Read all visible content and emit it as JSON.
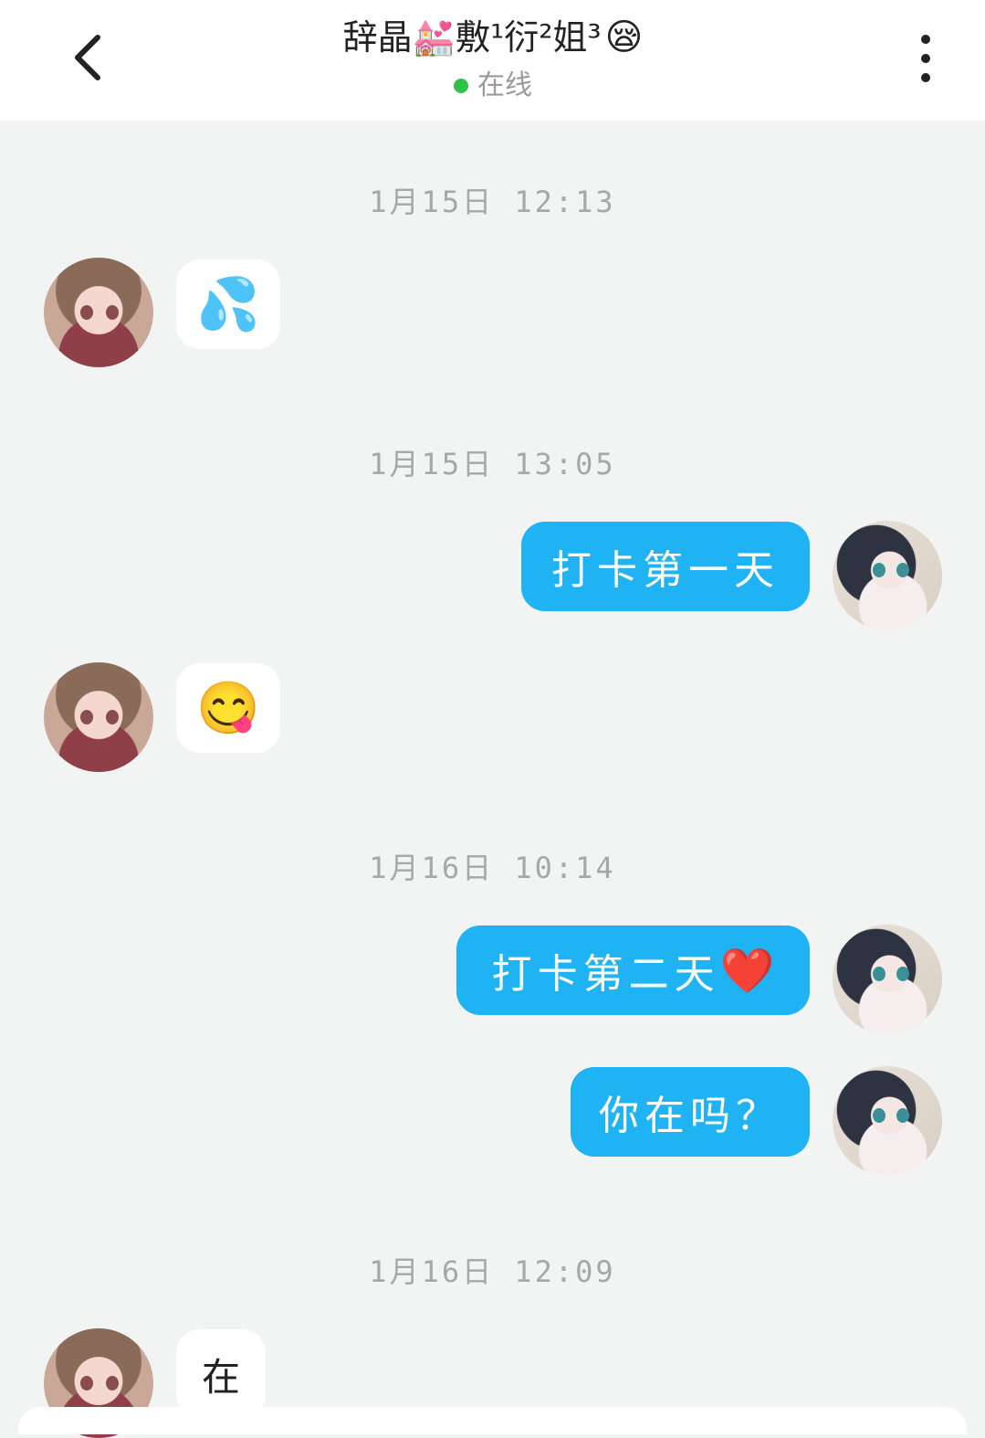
{
  "header": {
    "back_icon": "chevron-left-icon",
    "title": "辞晶💒敷¹衍²姐³",
    "title_emoji": "😪",
    "status": "在线",
    "status_color": "#2fc24a",
    "more_icon": "more-vertical-icon"
  },
  "messages": [
    {
      "type": "time",
      "text": "1月15日 12:13"
    },
    {
      "type": "msg",
      "side": "left",
      "text": "💦"
    },
    {
      "type": "time",
      "text": "1月15日 13:05"
    },
    {
      "type": "msg",
      "side": "right",
      "text": "打卡第一天"
    },
    {
      "type": "msg",
      "side": "left",
      "text": "😋"
    },
    {
      "type": "time",
      "text": "1月16日 10:14"
    },
    {
      "type": "msg",
      "side": "right",
      "text": "打卡第二天",
      "emoji": "❤️"
    },
    {
      "type": "msg",
      "side": "right",
      "text": "你在吗？"
    },
    {
      "type": "time",
      "text": "1月16日 12:09"
    },
    {
      "type": "msg",
      "side": "left",
      "text": "在"
    }
  ],
  "colors": {
    "bubble_self": "#1fb3f3",
    "bubble_other": "#ffffff",
    "background": "#f2f4f4"
  }
}
